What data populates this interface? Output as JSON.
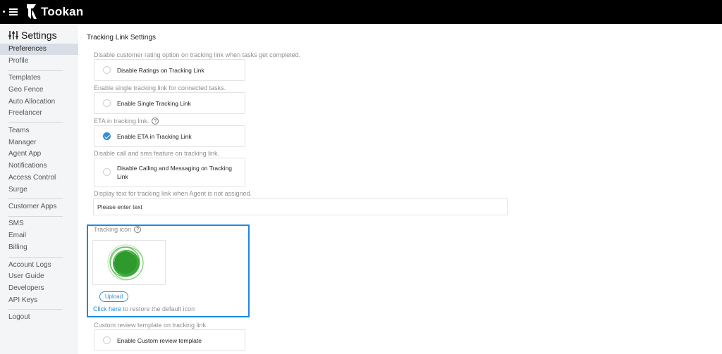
{
  "app": {
    "name": "Tookan"
  },
  "sidebar": {
    "title": "Settings",
    "items": [
      {
        "label": "Preferences",
        "active": true
      },
      {
        "label": "Profile"
      },
      {
        "label": "Templates"
      },
      {
        "label": "Geo Fence"
      },
      {
        "label": "Auto Allocation"
      },
      {
        "label": "Freelancer"
      },
      {
        "label": "Teams"
      },
      {
        "label": "Manager"
      },
      {
        "label": "Agent App"
      },
      {
        "label": "Notifications"
      },
      {
        "label": "Access Control"
      },
      {
        "label": "Surge"
      },
      {
        "label": "Customer Apps"
      },
      {
        "label": "SMS"
      },
      {
        "label": "Email"
      },
      {
        "label": "Billing"
      },
      {
        "label": "Account Logs"
      },
      {
        "label": "User Guide"
      },
      {
        "label": "Developers"
      },
      {
        "label": "API Keys"
      },
      {
        "label": "Logout"
      }
    ]
  },
  "main": {
    "section_title": "Tracking Link Settings",
    "options": [
      {
        "description": "Disable customer rating option on tracking link when tasks get completed.",
        "label": "Disable Ratings on Tracking Link",
        "checked": false
      },
      {
        "description": "Enable single tracking link for connected tasks.",
        "label": "Enable Single Tracking Link",
        "checked": false
      },
      {
        "description": "ETA in tracking link.",
        "label": "Enable ETA in Tracking Link",
        "checked": true,
        "help": "?"
      },
      {
        "description": "Disable call and sms feature on tracking link.",
        "label": "Disable Calling and Messaging on Tracking Link",
        "checked": false
      }
    ],
    "display_text": {
      "description": "Display text for tracking link when Agent is not assigned.",
      "placeholder": "Please enter text"
    },
    "tracking_icon": {
      "label": "Tracking icon",
      "help": "?",
      "icon_color": "#3aa83a",
      "upload_label": "Upload",
      "restore_link": "Click here",
      "restore_text": " to restore the default icon"
    },
    "review": {
      "description": "Custom review template on tracking link.",
      "label": "Enable Custom review template",
      "checked": false
    }
  },
  "colors": {
    "accent": "#1e88e5",
    "topbar": "#000000",
    "sidebar_bg": "#f4f5f7"
  }
}
